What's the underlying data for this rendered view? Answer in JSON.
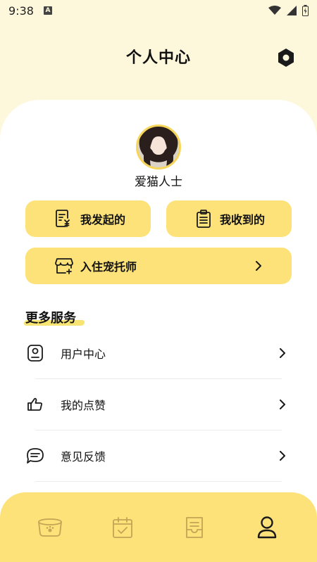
{
  "status_bar": {
    "time": "9:38",
    "a_badge": "A"
  },
  "header": {
    "title": "个人中心"
  },
  "profile": {
    "name": "爱猫人士"
  },
  "actions": {
    "initiated_label": "我发起的",
    "received_label": "我收到的",
    "petsitter_label": "入住宠托师"
  },
  "services": {
    "title": "更多服务",
    "items": [
      {
        "label": "用户中心",
        "icon": "user-card-icon"
      },
      {
        "label": "我的点赞",
        "icon": "thumb-up-icon"
      },
      {
        "label": "意见反馈",
        "icon": "feedback-icon"
      }
    ]
  },
  "bottom_nav": {
    "items": [
      {
        "icon": "pet-bowl-icon",
        "active": false
      },
      {
        "icon": "calendar-check-icon",
        "active": false
      },
      {
        "icon": "document-icon",
        "active": false
      },
      {
        "icon": "profile-icon",
        "active": true
      }
    ]
  },
  "colors": {
    "accent": "#fde27a",
    "highlight": "#f7df5a",
    "background": "#fdf7dc"
  }
}
